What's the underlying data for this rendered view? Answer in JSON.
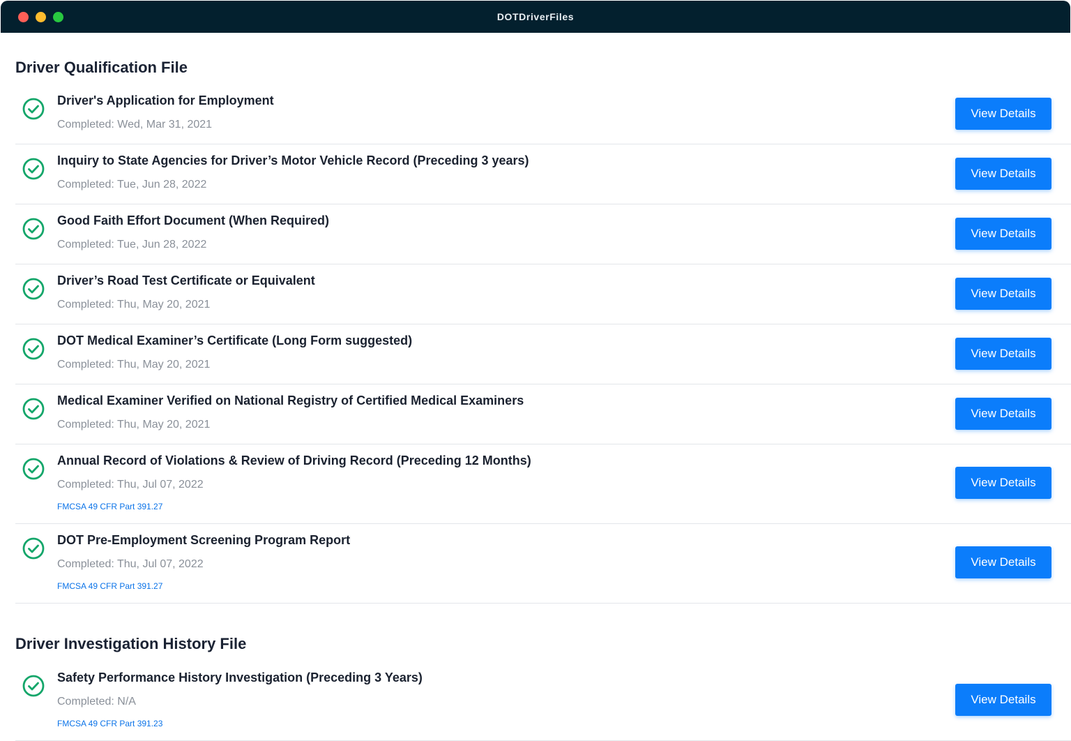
{
  "window": {
    "title": "DOTDriverFiles"
  },
  "sections": [
    {
      "title": "Driver Qualification File",
      "items": [
        {
          "title": "Driver's Application for Employment",
          "completed": "Completed: Wed, Mar 31, 2021",
          "reference": "",
          "button": "View Details"
        },
        {
          "title": "Inquiry to State Agencies for Driver’s Motor Vehicle Record (Preceding 3 years)",
          "completed": "Completed: Tue, Jun 28, 2022",
          "reference": "",
          "button": "View Details"
        },
        {
          "title": "Good Faith Effort Document (When Required)",
          "completed": "Completed: Tue, Jun 28, 2022",
          "reference": "",
          "button": "View Details"
        },
        {
          "title": "Driver’s Road Test Certificate or Equivalent",
          "completed": "Completed: Thu, May 20, 2021",
          "reference": "",
          "button": "View Details"
        },
        {
          "title": "DOT Medical Examiner’s Certificate (Long Form suggested)",
          "completed": "Completed: Thu, May 20, 2021",
          "reference": "",
          "button": "View Details"
        },
        {
          "title": "Medical Examiner Verified on National Registry of Certified Medical Examiners",
          "completed": "Completed: Thu, May 20, 2021",
          "reference": "",
          "button": "View Details"
        },
        {
          "title": "Annual Record of Violations & Review of Driving Record (Preceding 12 Months)",
          "completed": "Completed: Thu, Jul 07, 2022",
          "reference": "FMCSA 49 CFR Part 391.27",
          "button": "View Details"
        },
        {
          "title": "DOT Pre-Employment Screening Program Report",
          "completed": "Completed: Thu, Jul 07, 2022",
          "reference": "FMCSA 49 CFR Part 391.27",
          "button": "View Details"
        }
      ]
    },
    {
      "title": "Driver Investigation History File",
      "items": [
        {
          "title": "Safety Performance History Investigation (Preceding 3 Years)",
          "completed": "Completed: N/A",
          "reference": "FMCSA 49 CFR Part 391.23",
          "button": "View Details"
        }
      ]
    }
  ],
  "icons": {
    "status": "check-circle-icon"
  },
  "colors": {
    "titlebar": "#03202e",
    "accent": "#0b7dfb",
    "check": "#14a66a",
    "link": "#0b73e8"
  }
}
